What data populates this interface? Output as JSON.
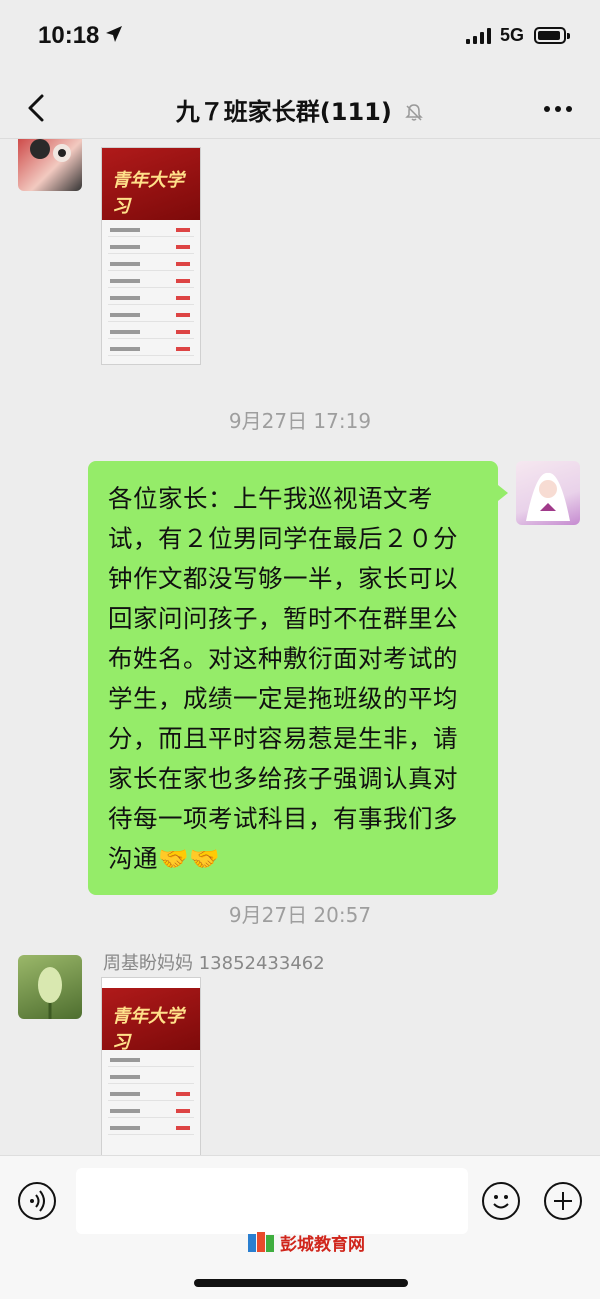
{
  "status_bar": {
    "time": "10:18",
    "network": "5G"
  },
  "nav": {
    "title": "九７班家长群(111)"
  },
  "messages": [
    {
      "type": "image",
      "poster_title": "青年大学习"
    },
    {
      "type": "timestamp",
      "text": "9月27日 17:19"
    },
    {
      "type": "text",
      "outgoing": true,
      "text": "各位家长：上午我巡视语文考试，有２位男同学在最后２０分钟作文都没写够一半，家长可以回家问问孩子，暂时不在群里公布姓名。对这种敷衍面对考试的学生，成绩一定是拖班级的平均分，而且平时容易惹是生非，请家长在家也多给孩子强调认真对待每一项考试科目，有事我们多沟通🤝🤝"
    },
    {
      "type": "timestamp",
      "text": "9月27日 20:57"
    },
    {
      "type": "image",
      "sender": "周基盼妈妈 13852433462",
      "poster_title": "青年大学习"
    }
  ],
  "watermark": {
    "text": "彭城教育网"
  },
  "colors": {
    "bubble_outgoing": "#95ec69",
    "background": "#ededed",
    "watermark": "#d0261c"
  },
  "icons": [
    "back-icon",
    "mute-icon",
    "more-icon",
    "voice-icon",
    "emoji-icon",
    "plus-icon"
  ]
}
